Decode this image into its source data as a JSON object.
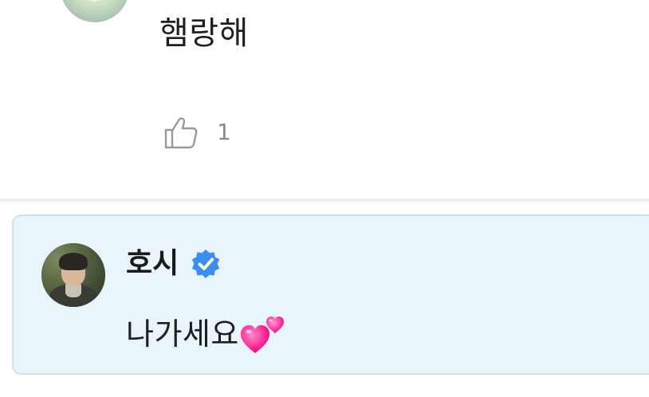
{
  "top_comment": {
    "text": "햄랑해",
    "like_count": "1"
  },
  "reply": {
    "author_name": "호시",
    "verified": true,
    "text": "나가세요",
    "emoji": "two-hearts-icon"
  },
  "colors": {
    "card_background": "#eaf4fb",
    "card_border": "#cfe1ee",
    "verified_badge": "#3b8ef0",
    "heart_pink": "#ff2f9a",
    "muted_text": "#8a8a8a"
  },
  "icons": {
    "like": "thumbs-up-outline-icon",
    "verified": "verified-badge-icon",
    "emoji": "two-hearts-icon"
  }
}
